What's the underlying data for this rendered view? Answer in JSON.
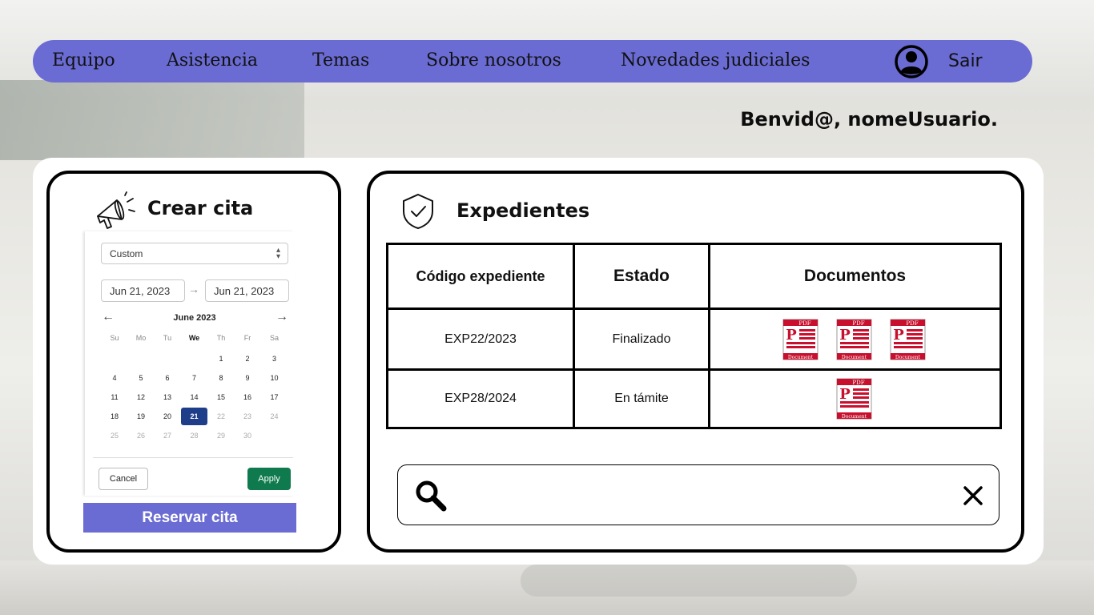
{
  "nav": {
    "items": [
      "Equipo",
      "Asistencia",
      "Temas",
      "Sobre nosotros",
      "Novedades judiciales"
    ],
    "logout_label": "Sair",
    "user_icon": "user-circle-icon"
  },
  "welcome": "Benvid@, nomeUsuario.",
  "appointment": {
    "title": "Crear cita",
    "icon": "megaphone-icon",
    "range_select": "Custom",
    "start_date": "Jun 21, 2023",
    "end_date": "Jun 21, 2023",
    "month_title": "June 2023",
    "weekdays": [
      "Su",
      "Mo",
      "Tu",
      "We",
      "Th",
      "Fr",
      "Sa"
    ],
    "weeks": [
      [
        "",
        "",
        "",
        "",
        "1",
        "2",
        "3"
      ],
      [
        "4",
        "5",
        "6",
        "7",
        "8",
        "9",
        "10"
      ],
      [
        "11",
        "12",
        "13",
        "14",
        "15",
        "16",
        "17"
      ],
      [
        "18",
        "19",
        "20",
        "21",
        "22",
        "23",
        "24"
      ],
      [
        "25",
        "26",
        "27",
        "28",
        "29",
        "30",
        ""
      ]
    ],
    "selected_day": "21",
    "cancel_label": "Cancel",
    "apply_label": "Apply",
    "reserve_label": "Reservar cita",
    "colors": {
      "accent": "#6a6bd3",
      "apply": "#0f7a4d",
      "selected": "#1f3e8a"
    }
  },
  "files": {
    "title": "Expedientes",
    "icon": "shield-check-icon",
    "columns": [
      "Código expediente",
      "Estado",
      "Documentos"
    ],
    "rows": [
      {
        "code": "EXP22/2023",
        "status": "Finalizado",
        "documents": 3
      },
      {
        "code": "EXP28/2024",
        "status": "En támite",
        "documents": 1
      }
    ],
    "pdf_icon_label": "PDF",
    "pdf_icon_caption": "Document"
  },
  "search": {
    "value": "",
    "placeholder": "",
    "search_icon": "search-icon",
    "clear_icon": "close-icon"
  }
}
